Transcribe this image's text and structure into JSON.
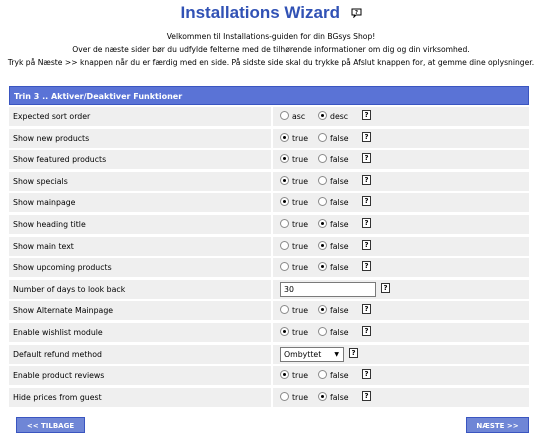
{
  "header": {
    "title": "Installations Wizard",
    "intro_lines": [
      "Velkommen til Installations-guiden for din BGsys Shop!",
      "Over de næste sider bør du udfylde felterne med de tilhørende informationer om dig og din virksomhed.",
      "Tryk på Næste >> knappen når du er færdig med en side. På sidste side skal du trykke på Afslut knappen for, at gemme dine oplysninger."
    ]
  },
  "step": {
    "title": "Trin 3 .. Aktiver/Deaktiver Funktioner"
  },
  "help_glyph": "?",
  "rows": [
    {
      "label": "Expected sort order",
      "type": "radio",
      "options": [
        "asc",
        "desc"
      ],
      "selected": 1
    },
    {
      "label": "Show new products",
      "type": "radio",
      "options": [
        "true",
        "false"
      ],
      "selected": 0
    },
    {
      "label": "Show featured products",
      "type": "radio",
      "options": [
        "true",
        "false"
      ],
      "selected": 0
    },
    {
      "label": "Show specials",
      "type": "radio",
      "options": [
        "true",
        "false"
      ],
      "selected": 0
    },
    {
      "label": "Show mainpage",
      "type": "radio",
      "options": [
        "true",
        "false"
      ],
      "selected": 0
    },
    {
      "label": "Show heading title",
      "type": "radio",
      "options": [
        "true",
        "false"
      ],
      "selected": 1
    },
    {
      "label": "Show main text",
      "type": "radio",
      "options": [
        "true",
        "false"
      ],
      "selected": 1
    },
    {
      "label": "Show upcoming products",
      "type": "radio",
      "options": [
        "true",
        "false"
      ],
      "selected": 1
    },
    {
      "label": "Number of days to look back",
      "type": "text",
      "value": "30"
    },
    {
      "label": "Show Alternate Mainpage",
      "type": "radio",
      "options": [
        "true",
        "false"
      ],
      "selected": 1
    },
    {
      "label": "Enable wishlist module",
      "type": "radio",
      "options": [
        "true",
        "false"
      ],
      "selected": 0
    },
    {
      "label": "Default refund method",
      "type": "select",
      "value": "Ombyttet"
    },
    {
      "label": "Enable product reviews",
      "type": "radio",
      "options": [
        "true",
        "false"
      ],
      "selected": 0
    },
    {
      "label": "Hide prices from guest",
      "type": "radio",
      "options": [
        "true",
        "false"
      ],
      "selected": 1
    }
  ],
  "buttons": {
    "back": "<< TILBAGE",
    "next": "NÆSTE >>"
  },
  "colors": {
    "title": "#3152b5",
    "panel_header": "#5a73d6",
    "row_bg": "#efefef",
    "button": "#6f86d6"
  }
}
